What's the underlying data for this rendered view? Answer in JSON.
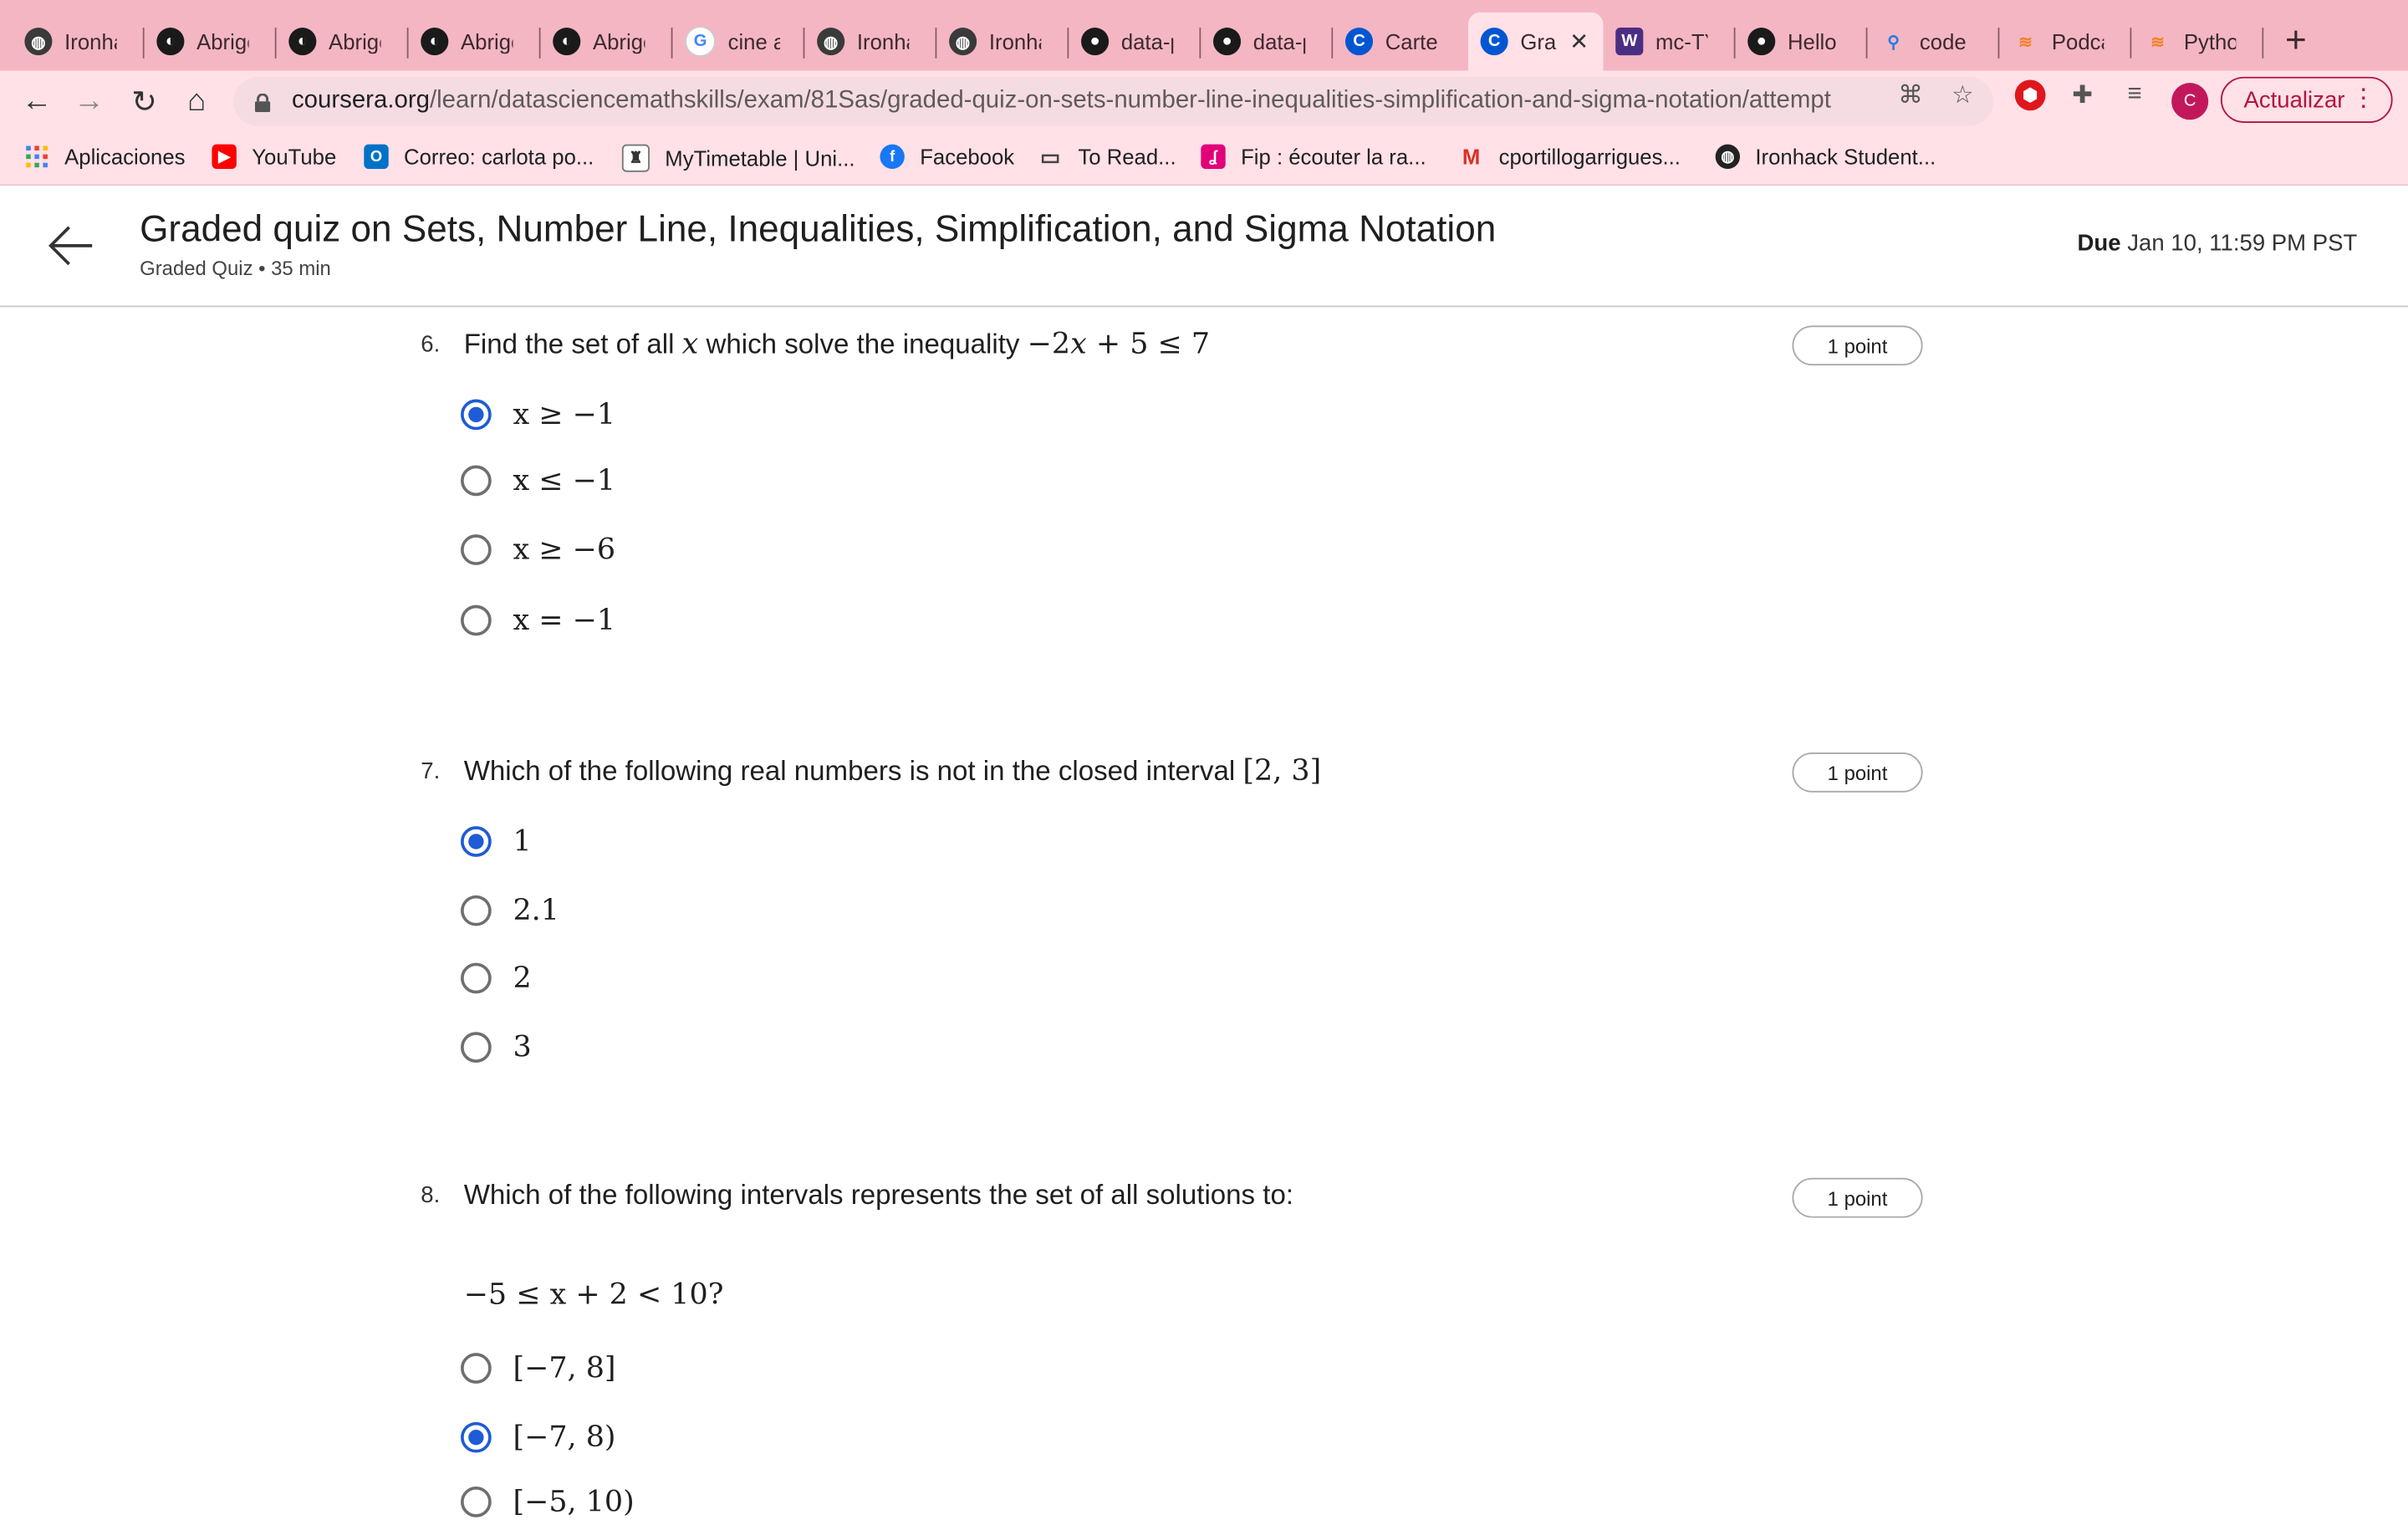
{
  "browser": {
    "tabs": [
      {
        "label": "Ironhac",
        "icon": "globe-icon",
        "active": false
      },
      {
        "label": "Abrigo",
        "icon": "vinted-icon",
        "active": false
      },
      {
        "label": "Abrigo",
        "icon": "vinted-icon",
        "active": false
      },
      {
        "label": "Abrigo",
        "icon": "vinted-icon",
        "active": false
      },
      {
        "label": "Abrigo",
        "icon": "vinted-icon",
        "active": false
      },
      {
        "label": "cine ab",
        "icon": "google-icon",
        "active": false
      },
      {
        "label": "Ironhac",
        "icon": "globe-icon",
        "active": false
      },
      {
        "label": "Ironhac",
        "icon": "globe-icon",
        "active": false
      },
      {
        "label": "data-p",
        "icon": "github-icon",
        "active": false
      },
      {
        "label": "data-p",
        "icon": "github-icon",
        "active": false
      },
      {
        "label": "Cartes",
        "icon": "coursera-icon",
        "active": false
      },
      {
        "label": "Gra",
        "icon": "coursera-icon",
        "active": true
      },
      {
        "label": "mc-TY",
        "icon": "shield-icon",
        "active": false
      },
      {
        "label": "Hello V",
        "icon": "github-icon",
        "active": false
      },
      {
        "label": "code g",
        "icon": "pin-icon",
        "active": false
      },
      {
        "label": "Podcas",
        "icon": "stack-icon",
        "active": false
      },
      {
        "label": "Python",
        "icon": "stack-icon",
        "active": false
      }
    ],
    "url_domain": "coursera.org",
    "url_path": "/learn/datasciencemathskills/exam/81Sas/graded-quiz-on-sets-number-line-inequalities-simplification-and-sigma-notation/attempt",
    "update_label": "Actualizar",
    "profile_initial": "C",
    "bookmarks": [
      {
        "label": "Aplicaciones",
        "icon": "apps-grid-icon"
      },
      {
        "label": "YouTube",
        "icon": "youtube-icon"
      },
      {
        "label": "Correo: carlota po...",
        "icon": "outlook-icon"
      },
      {
        "label": "MyTimetable | Uni...",
        "icon": "crest-icon"
      },
      {
        "label": "Facebook",
        "icon": "facebook-icon"
      },
      {
        "label": "To Read...",
        "icon": "folder-icon"
      },
      {
        "label": "Fip : écouter la ra...",
        "icon": "fip-icon"
      },
      {
        "label": "cportillogarrigues...",
        "icon": "gmail-icon"
      },
      {
        "label": "Ironhack Student...",
        "icon": "globe-icon"
      }
    ]
  },
  "header": {
    "title": "Graded quiz on Sets, Number Line, Inequalities, Simplification, and Sigma Notation",
    "subtitle": "Graded Quiz • 35 min",
    "due_label": "Due",
    "due_value": "Jan 10, 11:59 PM PST"
  },
  "questions": [
    {
      "number": "6.",
      "text": "Find the set of all x which solve the inequality −2x + 5 ≤ 7",
      "points": "1 point",
      "options": [
        {
          "label": "x ≥ −1",
          "selected": true
        },
        {
          "label": "x ≤ −1",
          "selected": false
        },
        {
          "label": "x ≥ −6",
          "selected": false
        },
        {
          "label": "x = −1",
          "selected": false
        }
      ]
    },
    {
      "number": "7.",
      "text": "Which of the following real numbers is not in the closed interval [2, 3]",
      "points": "1 point",
      "options": [
        {
          "label": "1",
          "selected": true
        },
        {
          "label": "2.1",
          "selected": false
        },
        {
          "label": "2",
          "selected": false
        },
        {
          "label": "3",
          "selected": false
        }
      ]
    },
    {
      "number": "8.",
      "text": "Which of the following intervals represents the set of all solutions to:",
      "expression": "−5 ≤ x + 2 < 10?",
      "points": "1 point",
      "options": [
        {
          "label": "[−7, 8]",
          "selected": false
        },
        {
          "label": "[−7, 8)",
          "selected": true
        },
        {
          "label": "[−5, 10)",
          "selected": false
        }
      ]
    }
  ]
}
